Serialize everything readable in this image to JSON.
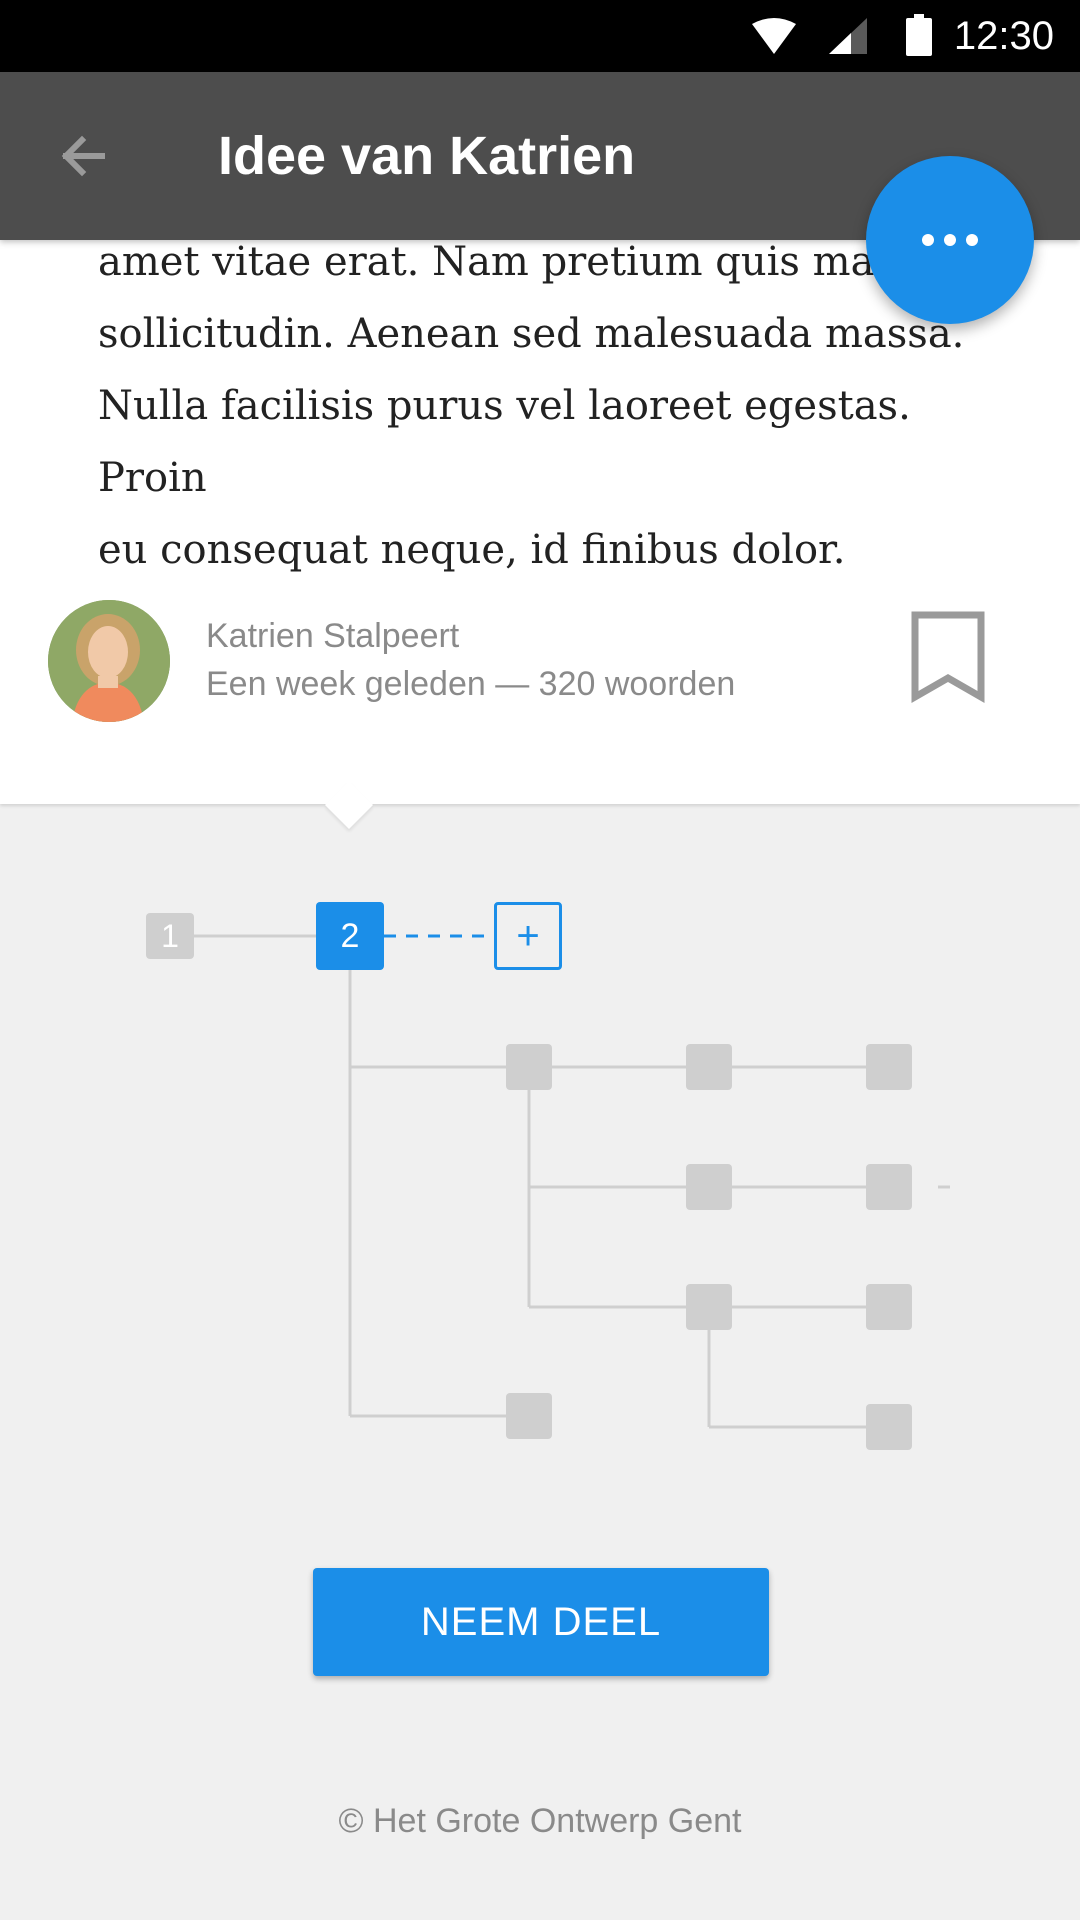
{
  "status_bar": {
    "time": "12:30",
    "icons": [
      "wifi-icon",
      "signal-icon",
      "battery-icon"
    ]
  },
  "app_bar": {
    "title": "Idee van Katrien",
    "back_icon": "arrow-left-icon"
  },
  "fab": {
    "icon": "more-horizontal-icon",
    "color": "#1b8ee8"
  },
  "article": {
    "lines": [
      "amet vitae erat. Nam pretium quis massa",
      "sollicitudin. Aenean sed malesuada massa.",
      "Nulla facilisis purus vel laoreet egestas. Proin",
      "eu consequat neque, id finibus dolor."
    ]
  },
  "author": {
    "name": "Katrien Stalpeert",
    "meta": "Een week geleden — 320 woorden",
    "bookmark_icon": "bookmark-icon"
  },
  "tree": {
    "nodes": [
      {
        "label": "1",
        "state": "inactive"
      },
      {
        "label": "2",
        "state": "active"
      },
      {
        "label": "+",
        "state": "add"
      }
    ]
  },
  "join_button": {
    "label": "NEEM DEEL"
  },
  "footer": {
    "text": "© Het Grote Ontwerp Gent"
  },
  "colors": {
    "accent": "#1b8ee8",
    "app_bar": "#4d4d4d",
    "background": "#f0f0f0",
    "node_grey": "#cfcfcf"
  }
}
